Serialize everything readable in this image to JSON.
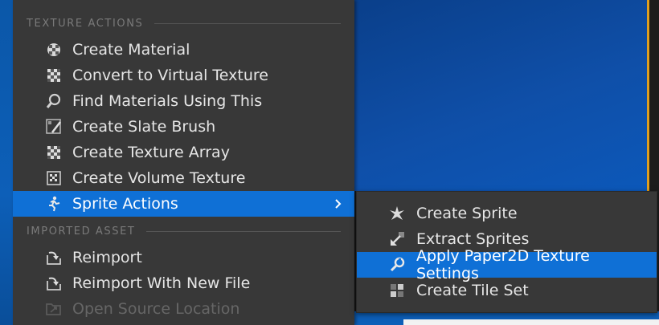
{
  "main_menu": {
    "texture_actions_header": "TEXTURE ACTIONS",
    "items": [
      {
        "label": "Create Material",
        "icon": "material-sphere-icon"
      },
      {
        "label": "Convert to Virtual Texture",
        "icon": "checker-icon"
      },
      {
        "label": "Find Materials Using This",
        "icon": "magnifier-icon"
      },
      {
        "label": "Create Slate Brush",
        "icon": "slate-brush-icon"
      },
      {
        "label": "Create Texture Array",
        "icon": "checker-icon"
      },
      {
        "label": "Create Volume Texture",
        "icon": "volume-texture-icon"
      },
      {
        "label": "Sprite Actions",
        "icon": "sprite-figure-icon"
      }
    ],
    "imported_asset_header": "IMPORTED ASSET",
    "imported_items": [
      {
        "label": "Reimport",
        "icon": "reimport-icon"
      },
      {
        "label": "Reimport With New File",
        "icon": "reimport-icon"
      },
      {
        "label": "Open Source Location",
        "icon": "folder-icon"
      }
    ]
  },
  "sprite_submenu": {
    "items": [
      {
        "label": "Create Sprite",
        "icon": "sprite-star-icon"
      },
      {
        "label": "Extract Sprites",
        "icon": "extract-arrow-icon"
      },
      {
        "label": "Apply Paper2D Texture Settings",
        "icon": "wrench-icon"
      },
      {
        "label": "Create Tile Set",
        "icon": "tile-set-icon"
      }
    ]
  },
  "colors": {
    "menu_bg": "#383838",
    "highlight": "#0f70d6",
    "text": "#e6e6e6",
    "header_text": "#7a7a7a"
  }
}
